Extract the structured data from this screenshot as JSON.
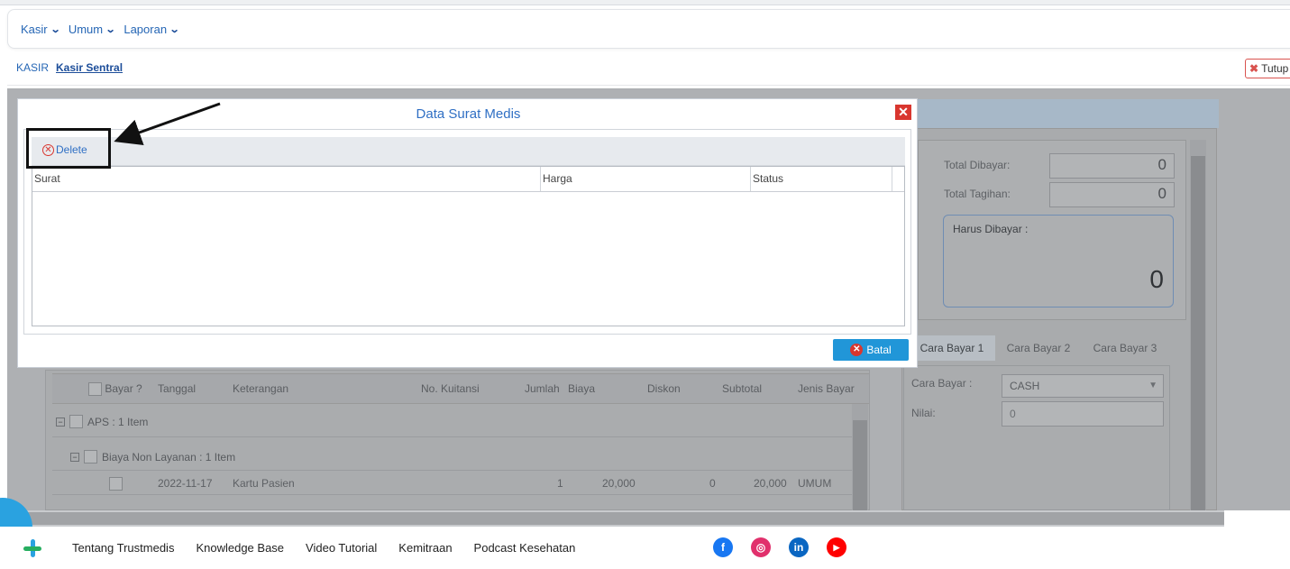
{
  "nav": {
    "items": [
      {
        "label": "Kasir"
      },
      {
        "label": "Umum"
      },
      {
        "label": "Laporan"
      }
    ]
  },
  "breadcrumb": {
    "root": "KASIR",
    "current": "Kasir Sentral"
  },
  "tutup_label": "Tutup",
  "background": {
    "total_dibayar_label": "Total Dibayar:",
    "total_dibayar_value": "0",
    "total_tagihan_label": "Total Tagihan:",
    "total_tagihan_value": "0",
    "harus_dibayar_label": "Harus Dibayar :",
    "harus_dibayar_value": "0",
    "tabs": [
      "Cara Bayar 1",
      "Cara Bayar 2",
      "Cara Bayar 3"
    ],
    "cara_bayar_label": "Cara Bayar :",
    "cara_bayar_value": "CASH",
    "nilai_label": "Nilai:",
    "nilai_value": "0",
    "table_headers": [
      "Bayar ?",
      "Tanggal",
      "Keterangan",
      "No. Kuitansi",
      "Jumlah",
      "Biaya",
      "Diskon",
      "Subtotal",
      "Jenis Bayar"
    ],
    "group1": "APS : 1 Item",
    "group2": "Biaya Non Layanan : 1 Item",
    "row": {
      "tanggal": "2022-11-17",
      "keterangan": "Kartu Pasien",
      "jumlah": "1",
      "biaya": "20,000",
      "diskon": "0",
      "subtotal": "20,000",
      "jenis_bayar": "UMUM"
    }
  },
  "modal": {
    "title": "Data Surat Medis",
    "delete_label": "Delete",
    "columns": [
      "Surat",
      "Harga",
      "Status"
    ],
    "batal_label": "Batal"
  },
  "footer": {
    "links": [
      "Tentang Trustmedis",
      "Knowledge Base",
      "Video Tutorial",
      "Kemitraan",
      "Podcast Kesehatan"
    ],
    "social": [
      {
        "name": "facebook-icon",
        "color": "#1877f2",
        "glyph": "f"
      },
      {
        "name": "instagram-icon",
        "color": "#e1306c",
        "glyph": "◎"
      },
      {
        "name": "linkedin-icon",
        "color": "#0a66c2",
        "glyph": "in"
      },
      {
        "name": "youtube-icon",
        "color": "#ff0000",
        "glyph": "▶"
      }
    ]
  }
}
